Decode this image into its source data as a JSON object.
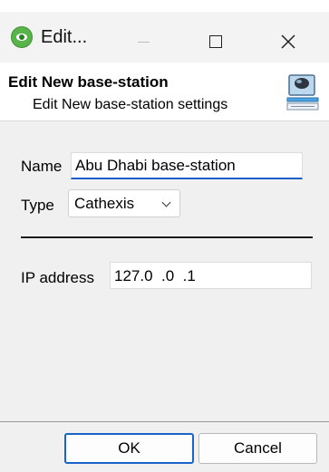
{
  "window": {
    "title": "Edit..."
  },
  "header": {
    "title": "Edit New base-station",
    "subtitle": "Edit New base-station settings"
  },
  "form": {
    "name_label": "Name",
    "name_value": "Abu Dhabi base-station",
    "type_label": "Type",
    "type_value": "Cathexis",
    "ip_label": "IP address",
    "ip_value": "127.0  .0  .1"
  },
  "buttons": {
    "ok": "OK",
    "cancel": "Cancel"
  },
  "icons": {
    "app": "cathexis-eye-icon",
    "header": "computer-monitor-icon",
    "minimize": "minimize-icon",
    "maximize": "maximize-icon",
    "close": "close-icon",
    "dropdown": "chevron-down-icon"
  },
  "colors": {
    "accent": "#1b60c9",
    "app_icon": "#58b54a"
  }
}
